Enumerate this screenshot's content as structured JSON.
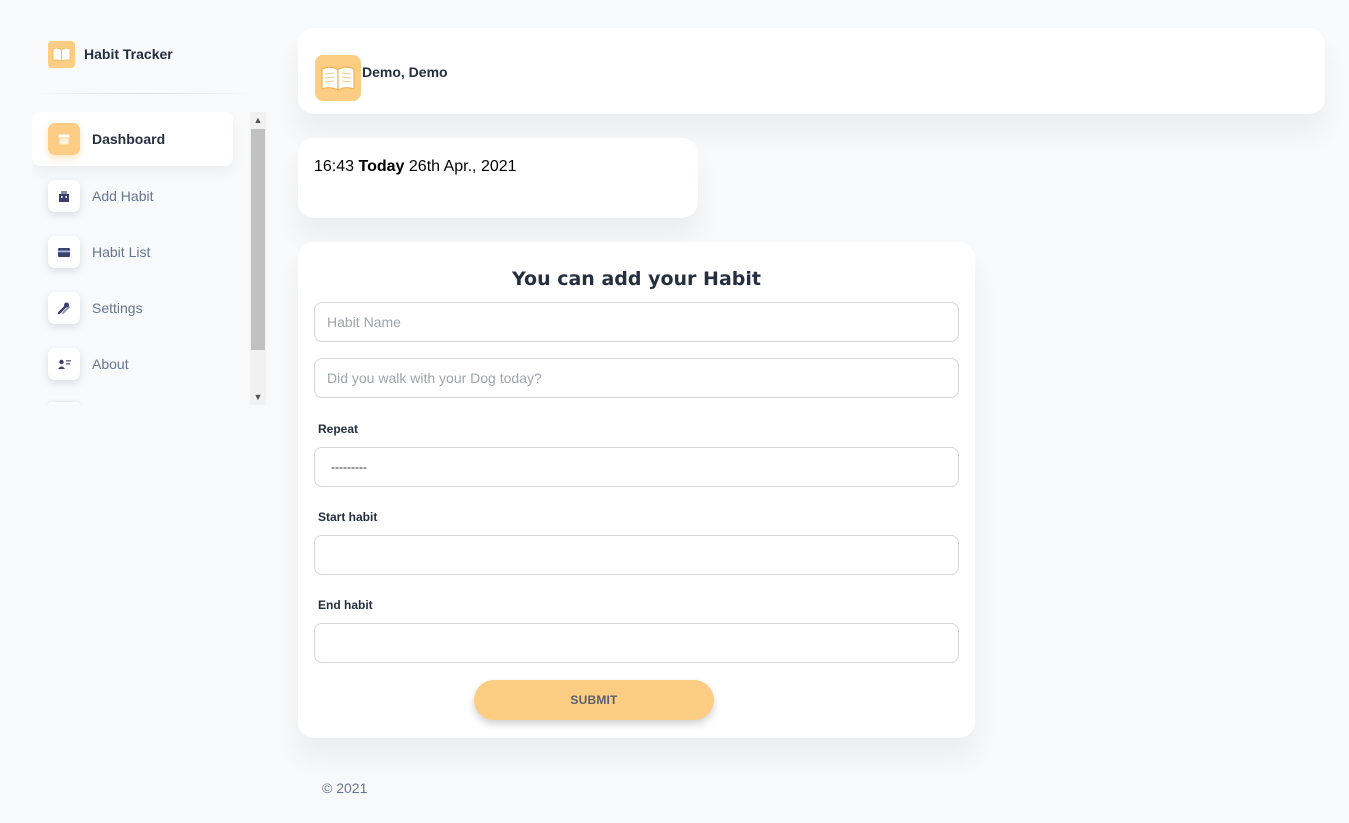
{
  "brand": {
    "title": "Habit Tracker",
    "icon": "book-icon"
  },
  "sidebar": {
    "items": [
      {
        "label": "Dashboard",
        "icon": "shop-icon",
        "active": true
      },
      {
        "label": "Add Habit",
        "icon": "office-icon",
        "active": false
      },
      {
        "label": "Habit List",
        "icon": "credit-card-icon",
        "active": false
      },
      {
        "label": "Settings",
        "icon": "settings-tools-icon",
        "active": false
      },
      {
        "label": "About",
        "icon": "user-card-icon",
        "active": false
      }
    ]
  },
  "header": {
    "user_name": "Demo, Demo",
    "avatar_icon": "book-icon"
  },
  "clock": {
    "time": "16:43",
    "today_label": "Today",
    "date": "26th Apr., 2021"
  },
  "form": {
    "title": "You can add your Habit",
    "name_placeholder": "Habit Name",
    "description_placeholder": "Did you walk with your Dog today?",
    "repeat_label": "Repeat",
    "repeat_value": "---------",
    "start_label": "Start habit",
    "start_value": "",
    "end_label": "End habit",
    "end_value": "",
    "submit_label": "SUBMIT"
  },
  "footer": {
    "text": "© 2021"
  },
  "colors": {
    "accent": "#fdcd84",
    "text_dark": "#252f40",
    "text_muted": "#67748e",
    "background": "#f8f9fb"
  }
}
